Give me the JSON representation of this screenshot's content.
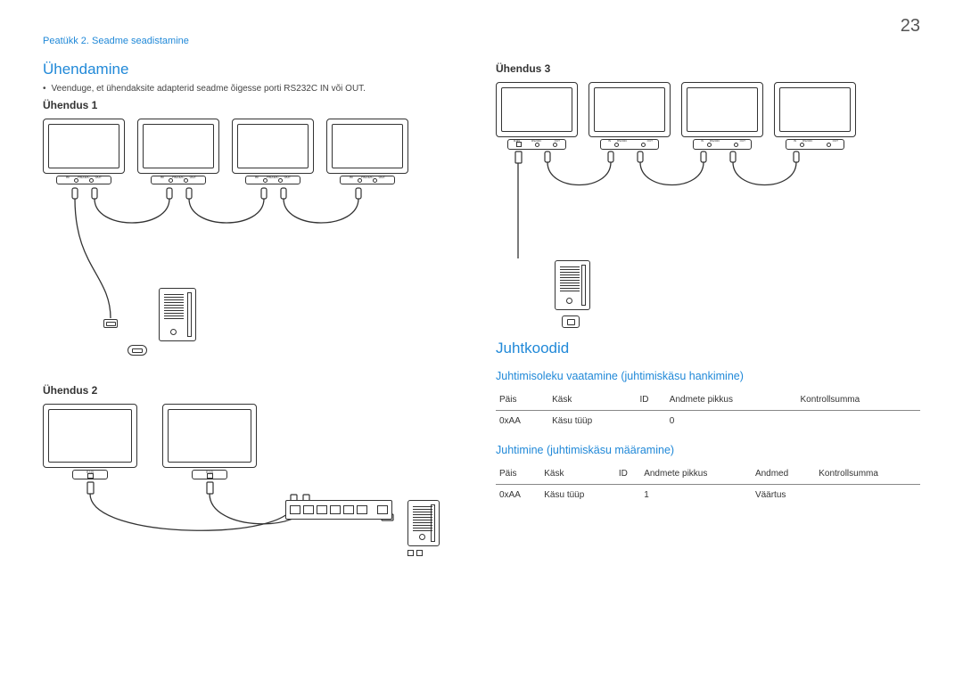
{
  "header": {
    "chapter": "Peatükk 2. Seadme seadistamine",
    "page_number": "23"
  },
  "left": {
    "section_title": "Ühendamine",
    "bullet": "Veenduge, et ühendaksite adapterid seadme õigesse porti RS232C IN või OUT.",
    "conn1_label": "Ühendus 1",
    "conn2_label": "Ühendus 2",
    "port_rs232c": "RS232C",
    "port_in": "IN",
    "port_out": "OUT",
    "port_rj45": "RJ45"
  },
  "right": {
    "conn3_label": "Ühendus 3",
    "section_codes": "Juhtkoodid",
    "subsection_view": "Juhtimisoleku vaatamine (juhtimiskäsu hankimine)",
    "subsection_set": "Juhtimine (juhtimiskäsu määramine)",
    "table1": {
      "headers": [
        "Päis",
        "Käsk",
        "ID",
        "Andmete pikkus",
        "Kontrollsumma"
      ],
      "row": [
        "0xAA",
        "Käsu tüüp",
        "",
        "0",
        ""
      ]
    },
    "table2": {
      "headers": [
        "Päis",
        "Käsk",
        "ID",
        "Andmete pikkus",
        "Andmed",
        "Kontrollsumma"
      ],
      "row": [
        "0xAA",
        "Käsu tüüp",
        "",
        "1",
        "Väärtus",
        ""
      ]
    },
    "port_rj45": "RJ45",
    "port_rs232c": "RS232C",
    "port_in": "IN",
    "port_out": "OUT"
  }
}
